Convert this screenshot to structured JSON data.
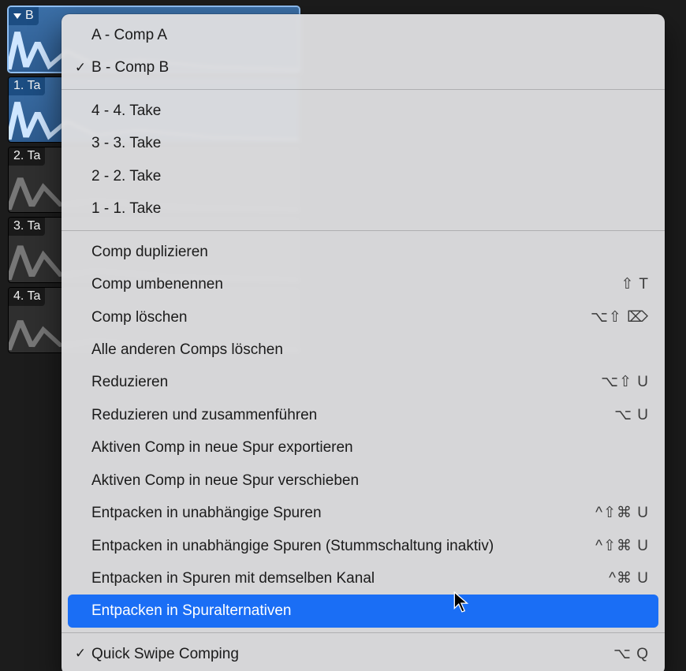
{
  "tracks": [
    {
      "label": "B",
      "kind": "sel",
      "disclosure": true
    },
    {
      "label": "1. Ta",
      "kind": "blue",
      "disclosure": false
    },
    {
      "label": "2. Ta",
      "kind": "dim",
      "disclosure": false
    },
    {
      "label": "3. Ta",
      "kind": "dim",
      "disclosure": false
    },
    {
      "label": "4. Ta",
      "kind": "dim",
      "disclosure": false
    }
  ],
  "menu": {
    "sections": [
      [
        {
          "label": "A - Comp A",
          "checked": false
        },
        {
          "label": "B - Comp B",
          "checked": true
        }
      ],
      [
        {
          "label": "4 - 4. Take"
        },
        {
          "label": "3 - 3. Take"
        },
        {
          "label": "2 - 2. Take"
        },
        {
          "label": "1 - 1. Take"
        }
      ],
      [
        {
          "label": "Comp duplizieren"
        },
        {
          "label": "Comp umbenennen",
          "shortcut": "⇧ T"
        },
        {
          "label": "Comp löschen",
          "shortcut": "⌥⇧ ⌦"
        },
        {
          "label": "Alle anderen Comps löschen"
        },
        {
          "label": "Reduzieren",
          "shortcut": "⌥⇧ U"
        },
        {
          "label": "Reduzieren und zusammenführen",
          "shortcut": "⌥ U"
        },
        {
          "label": "Aktiven Comp in neue Spur exportieren"
        },
        {
          "label": "Aktiven Comp in neue Spur verschieben"
        },
        {
          "label": "Entpacken in unabhängige Spuren",
          "shortcut": "^⇧⌘ U"
        },
        {
          "label": "Entpacken in unabhängige Spuren (Stummschaltung inaktiv)",
          "shortcut": "^⇧⌘ U"
        },
        {
          "label": "Entpacken in Spuren mit demselben Kanal",
          "shortcut": "^⌘ U"
        },
        {
          "label": "Entpacken in Spuralternativen",
          "highlight": true
        }
      ],
      [
        {
          "label": "Quick Swipe Comping",
          "checked": true,
          "shortcut": "⌥ Q"
        }
      ]
    ]
  }
}
